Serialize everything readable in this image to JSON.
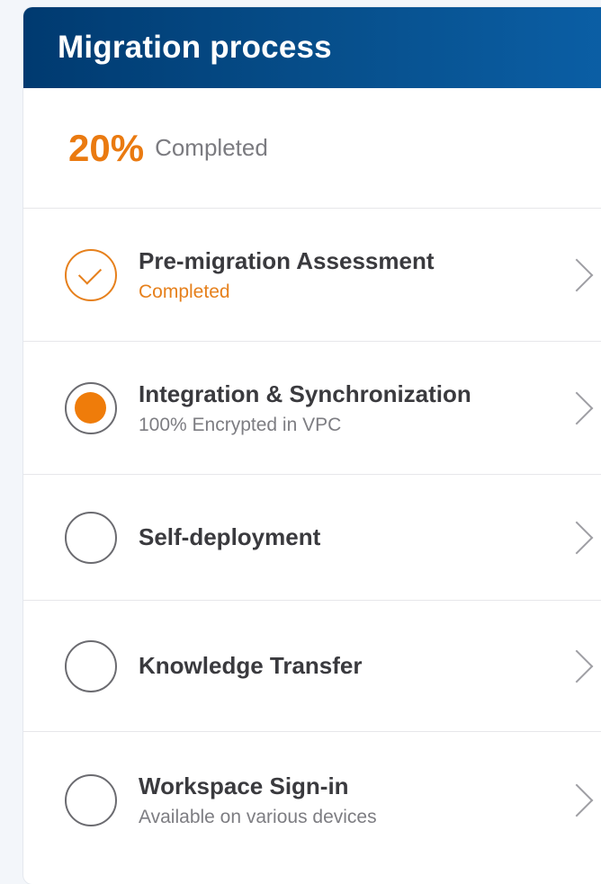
{
  "header": {
    "title": "Migration process"
  },
  "progress": {
    "percent": "20%",
    "label": "Completed"
  },
  "steps": [
    {
      "title": "Pre-migration Assessment",
      "subtitle": "Completed",
      "state": "completed",
      "icon": "check-circle-icon"
    },
    {
      "title": "Integration & Synchronization",
      "subtitle": "100% Encrypted in VPC",
      "state": "active",
      "icon": "radio-selected-icon"
    },
    {
      "title": "Self-deployment",
      "subtitle": "",
      "state": "pending",
      "icon": "radio-empty-icon"
    },
    {
      "title": "Knowledge Transfer",
      "subtitle": "",
      "state": "pending",
      "icon": "radio-empty-icon"
    },
    {
      "title": "Workspace Sign-in",
      "subtitle": "Available on various devices",
      "state": "pending",
      "icon": "radio-empty-icon"
    }
  ],
  "colors": {
    "header_gradient_start": "#003a70",
    "header_gradient_end": "#0b5fa6",
    "accent_orange": "#ea7a10",
    "text_dark": "#3a3a3e",
    "text_muted": "#7d7d82"
  }
}
